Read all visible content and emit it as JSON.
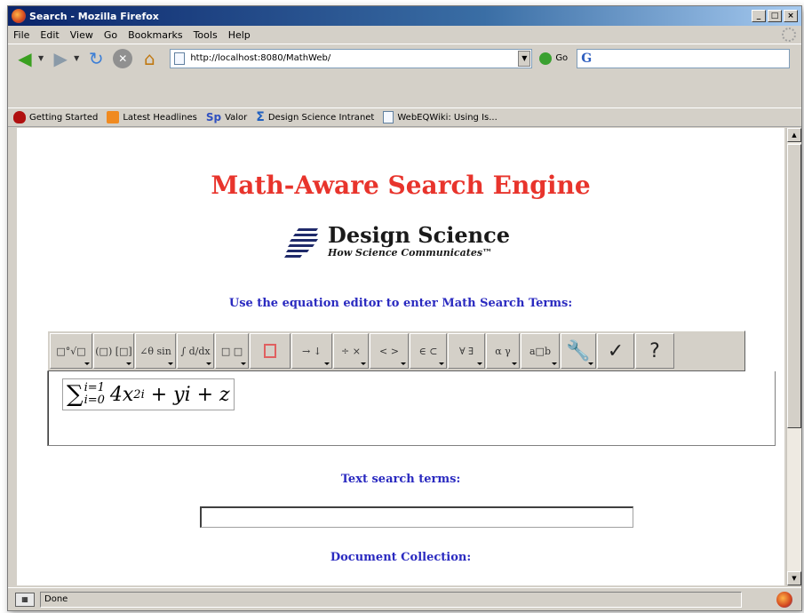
{
  "window": {
    "title": "Search - Mozilla Firefox",
    "controls": [
      "_",
      "□",
      "×"
    ]
  },
  "menu": [
    "File",
    "Edit",
    "View",
    "Go",
    "Bookmarks",
    "Tools",
    "Help"
  ],
  "nav": {
    "url": "http://localhost:8080/MathWeb/",
    "go_label": "Go",
    "search_engine_icon": "G"
  },
  "bookmarks": [
    {
      "label": "Getting Started",
      "icon": "firefox-icon"
    },
    {
      "label": "Latest Headlines",
      "icon": "rss-icon"
    },
    {
      "label": "Valor",
      "icon": "sp-icon"
    },
    {
      "label": "Design Science Intranet",
      "icon": "sigma-icon"
    },
    {
      "label": "WebEQWiki: Using Is...",
      "icon": "page-icon"
    }
  ],
  "page": {
    "title": "Math-Aware Search Engine",
    "logo_name": "Design Science",
    "logo_tagline": "How Science Communicates™",
    "equation_prompt": "Use the equation editor to enter Math Search Terms:",
    "text_search_label": "Text search terms:",
    "text_search_value": "",
    "collection_label": "Document Collection:"
  },
  "equation_toolbar": [
    {
      "label": "□°√□",
      "w": 48
    },
    {
      "label": "(□) [□]",
      "w": 46
    },
    {
      "label": "∠θ sin",
      "w": 46
    },
    {
      "label": "∫ d/dx",
      "w": 42
    },
    {
      "label": "□ □",
      "w": 38
    },
    {
      "label": "",
      "w": 46
    },
    {
      "label": "→ ↓",
      "w": 46
    },
    {
      "label": "÷ ×",
      "w": 40
    },
    {
      "label": "< >",
      "w": 44
    },
    {
      "label": "∈ ⊂",
      "w": 42
    },
    {
      "label": "∀ ∃",
      "w": 42
    },
    {
      "label": "α γ",
      "w": 38
    },
    {
      "label": "a□b",
      "w": 44
    },
    {
      "label": "🔧",
      "w": 40
    },
    {
      "label": "✓",
      "w": 42
    },
    {
      "label": "?",
      "w": 44
    }
  ],
  "formula": {
    "sigma": "∑",
    "upper": "i=1",
    "lower": "i=0",
    "term1": "4x",
    "exp1": "2i",
    "rest": " + yi + z"
  },
  "status": {
    "text": "Done"
  }
}
